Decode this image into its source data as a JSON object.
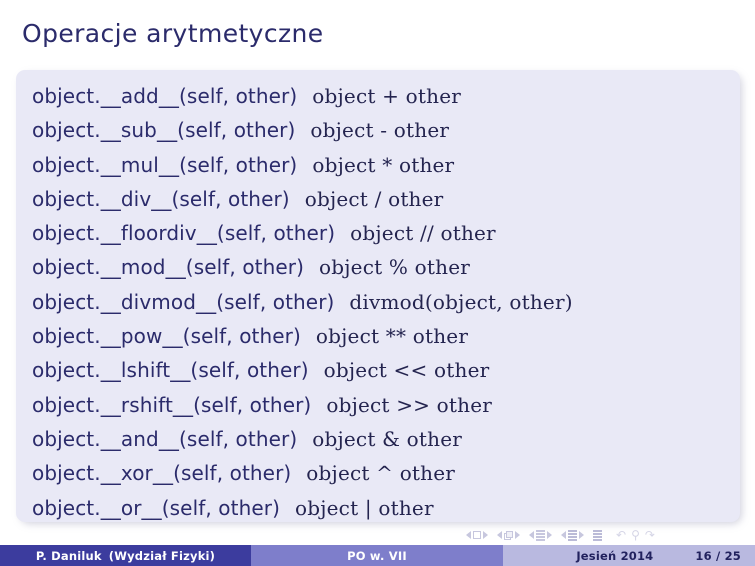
{
  "slide": {
    "title": "Operacje arytmetyczne",
    "accent_navy": "#2b2b6b",
    "block_bg": "#e9e9f6",
    "footer_author_bg": "#3c3c9e",
    "footer_title_bg": "#7e7ecb",
    "footer_date_bg": "#b9b9e0"
  },
  "block": {
    "rows": [
      {
        "signature": "object.__add__(self, other)",
        "expression": "object + other"
      },
      {
        "signature": "object.__sub__(self, other)",
        "expression": "object - other"
      },
      {
        "signature": "object.__mul__(self, other)",
        "expression": "object * other"
      },
      {
        "signature": "object.__div__(self, other)",
        "expression": "object / other"
      },
      {
        "signature": "object.__floordiv__(self, other)",
        "expression": "object // other"
      },
      {
        "signature": "object.__mod__(self, other)",
        "expression": "object % other"
      },
      {
        "signature": "object.__divmod__(self, other)",
        "expression": "divmod(object, other)"
      },
      {
        "signature": "object.__pow__(self, other)",
        "expression": "object ** other"
      },
      {
        "signature": "object.__lshift__(self, other)",
        "expression": "object << other"
      },
      {
        "signature": "object.__rshift__(self, other)",
        "expression": "object >> other"
      },
      {
        "signature": "object.__and__(self, other)",
        "expression": "object & other"
      },
      {
        "signature": "object.__xor__(self, other)",
        "expression": "object ^ other"
      },
      {
        "signature": "object.__or__(self, other)",
        "expression": "object | other"
      }
    ]
  },
  "navigation": {
    "icons": [
      "slide-prev-icon",
      "slide-current-icon",
      "slide-next-icon",
      "frame-prev-icon",
      "frame-current-icon",
      "frame-next-icon",
      "subsection-prev-icon",
      "subsection-current-icon",
      "subsection-next-icon",
      "section-prev-icon",
      "section-current-icon",
      "section-next-icon",
      "doc-icon",
      "back-icon",
      "search-icon",
      "forward-icon"
    ]
  },
  "footer": {
    "author": "P. Daniluk",
    "affiliation": "(Wydział Fizyki)",
    "short_title": "PO w. VII",
    "date": "Jesień 2014",
    "page": "16 / 25"
  }
}
